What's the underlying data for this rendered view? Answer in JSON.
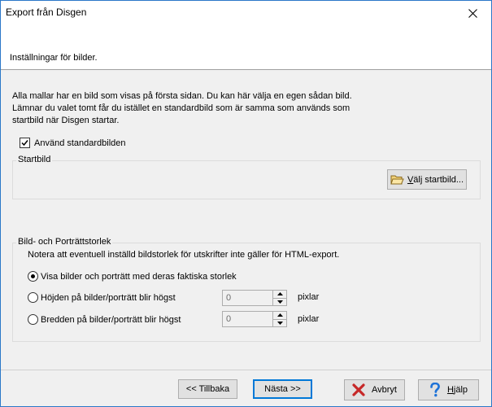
{
  "window": {
    "title": "Export från Disgen",
    "header": "Inställningar för bilder."
  },
  "intro": {
    "line1": "Alla mallar har en bild som visas på första sidan. Du kan här välja en egen sådan bild.",
    "line2": "Lämnar du valet tomt får du istället en standardbild som är samma som används som",
    "line3": "startbild när Disgen startar."
  },
  "use_default": {
    "label": "Använd standardbilden",
    "checked": true
  },
  "startbild": {
    "group_label": "Startbild",
    "button_label_accel": "V",
    "button_label_rest": "älj startbild..."
  },
  "size_group": {
    "group_label": "Bild- och Porträttstorlek",
    "note": "Notera att eventuell inställd bildstorlek för utskrifter inte gäller för HTML-export.",
    "options": [
      {
        "label": "Visa bilder och porträtt med deras faktiska storlek",
        "selected": true
      },
      {
        "label": "Höjden på bilder/porträtt blir högst",
        "selected": false,
        "value": "0",
        "unit": "pixlar"
      },
      {
        "label": "Bredden på bilder/porträtt blir högst",
        "selected": false,
        "value": "0",
        "unit": "pixlar"
      }
    ]
  },
  "buttons": {
    "back": "<< Tillbaka",
    "next": "Nästa >>",
    "cancel": "Avbryt",
    "help_accel": "H",
    "help_rest": "jälp"
  },
  "colors": {
    "cancel_icon": "#c62828",
    "help_icon": "#1e73d8",
    "accent": "#0078d7"
  }
}
